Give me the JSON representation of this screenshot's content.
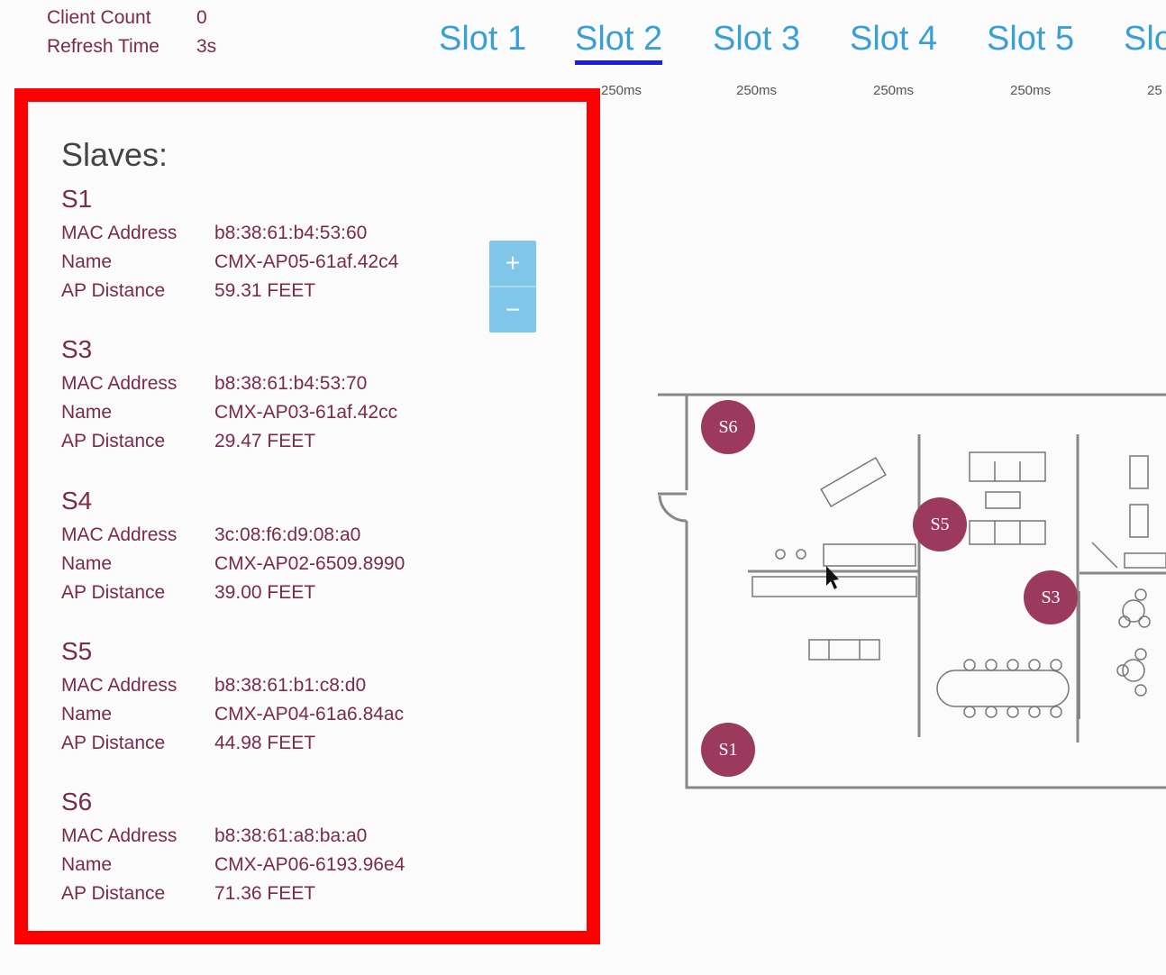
{
  "header": {
    "client_count_label": "Client Count",
    "client_count_value": "0",
    "refresh_time_label": "Refresh Time",
    "refresh_time_value": "3s"
  },
  "tabs": [
    {
      "label": "Slot 1",
      "rate": "250ms",
      "active": false
    },
    {
      "label": "Slot 2",
      "rate": "250ms",
      "active": true
    },
    {
      "label": "Slot 3",
      "rate": "250ms",
      "active": false
    },
    {
      "label": "Slot 4",
      "rate": "250ms",
      "active": false
    },
    {
      "label": "Slot 5",
      "rate": "250ms",
      "active": false
    },
    {
      "label": "Slo",
      "rate": "25",
      "active": false
    }
  ],
  "panel": {
    "title": "Slaves:",
    "labels": {
      "mac": "MAC Address",
      "name": "Name",
      "distance": "AP Distance"
    },
    "slaves": [
      {
        "id": "S1",
        "mac": "b8:38:61:b4:53:60",
        "name": "CMX-AP05-61af.42c4",
        "distance": "59.31 FEET"
      },
      {
        "id": "S3",
        "mac": "b8:38:61:b4:53:70",
        "name": "CMX-AP03-61af.42cc",
        "distance": "29.47 FEET"
      },
      {
        "id": "S4",
        "mac": "3c:08:f6:d9:08:a0",
        "name": "CMX-AP02-6509.8990",
        "distance": "39.00 FEET"
      },
      {
        "id": "S5",
        "mac": "b8:38:61:b1:c8:d0",
        "name": "CMX-AP04-61a6.84ac",
        "distance": "44.98 FEET"
      },
      {
        "id": "S6",
        "mac": "b8:38:61:a8:ba:a0",
        "name": "CMX-AP06-6193.96e4",
        "distance": "71.36 FEET"
      }
    ]
  },
  "zoom": {
    "in": "+",
    "out": "−"
  },
  "map": {
    "markers": [
      {
        "label": "S6"
      },
      {
        "label": "S5"
      },
      {
        "label": "S3"
      },
      {
        "label": "S1"
      }
    ]
  },
  "colors": {
    "accent_tab": "#3a9fd6",
    "active_underline": "#1f1ee0",
    "marker": "#9b3a5d",
    "panel_border": "#ff0000"
  }
}
